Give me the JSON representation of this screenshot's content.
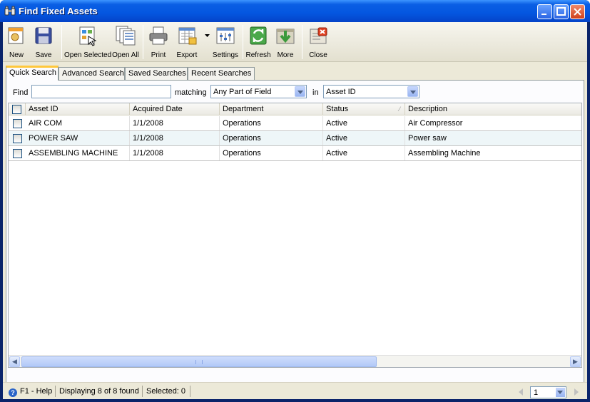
{
  "window": {
    "title": "Find Fixed Assets"
  },
  "toolbar": {
    "new": "New",
    "save": "Save",
    "open_selected": "Open Selected",
    "open_all": "Open All",
    "print": "Print",
    "export": "Export",
    "settings": "Settings",
    "refresh": "Refresh",
    "more": "More",
    "close": "Close"
  },
  "tabs": [
    "Quick Search",
    "Advanced Search",
    "Saved Searches",
    "Recent Searches"
  ],
  "search": {
    "find_label": "Find",
    "find_value": "",
    "matching_label": "matching",
    "matching_value": "Any Part of Field",
    "in_label": "in",
    "in_value": "Asset ID"
  },
  "grid": {
    "columns": [
      "Asset ID",
      "Acquired Date",
      "Department",
      "Status",
      "Description"
    ],
    "rows": [
      [
        "AIR COM",
        "1/1/2008",
        "Operations",
        "Active",
        "Air Compressor"
      ],
      [
        "POWER SAW",
        "1/1/2008",
        "Operations",
        "Active",
        "Power saw"
      ],
      [
        "ASSEMBLING MACHINE",
        "1/1/2008",
        "Operations",
        "Active",
        "Assembling Machine"
      ]
    ]
  },
  "status": {
    "help": "F1 - Help",
    "displaying": "Displaying 8 of 8 found",
    "selected": "Selected: 0",
    "page": "1"
  }
}
